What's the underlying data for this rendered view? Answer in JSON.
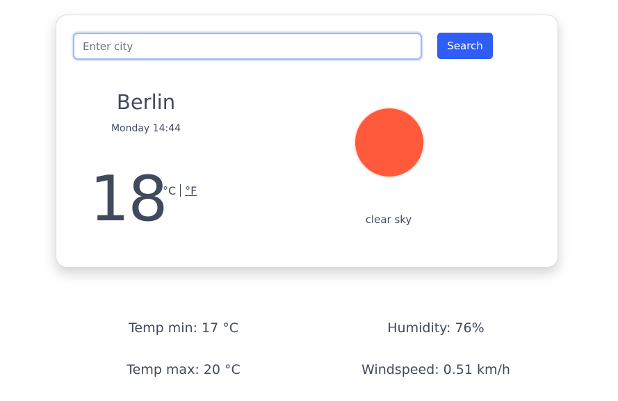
{
  "search": {
    "placeholder": "Enter city",
    "value": "",
    "button_label": "Search"
  },
  "weather": {
    "city": "Berlin",
    "datetime": "Monday 14:44",
    "temperature": "18",
    "unit_celsius": "°C",
    "unit_fahrenheit": "°F",
    "description": "clear sky",
    "icon": "sun-icon",
    "icon_color": "#ff5a3c"
  },
  "stats": {
    "temp_min": "Temp min: 17 °C",
    "temp_max": "Temp max: 20 °C",
    "humidity": "Humidity: 76%",
    "windspeed": "Windspeed: 0.51 km/h"
  },
  "colors": {
    "accent": "#2f5df5",
    "text": "#414a5c"
  }
}
